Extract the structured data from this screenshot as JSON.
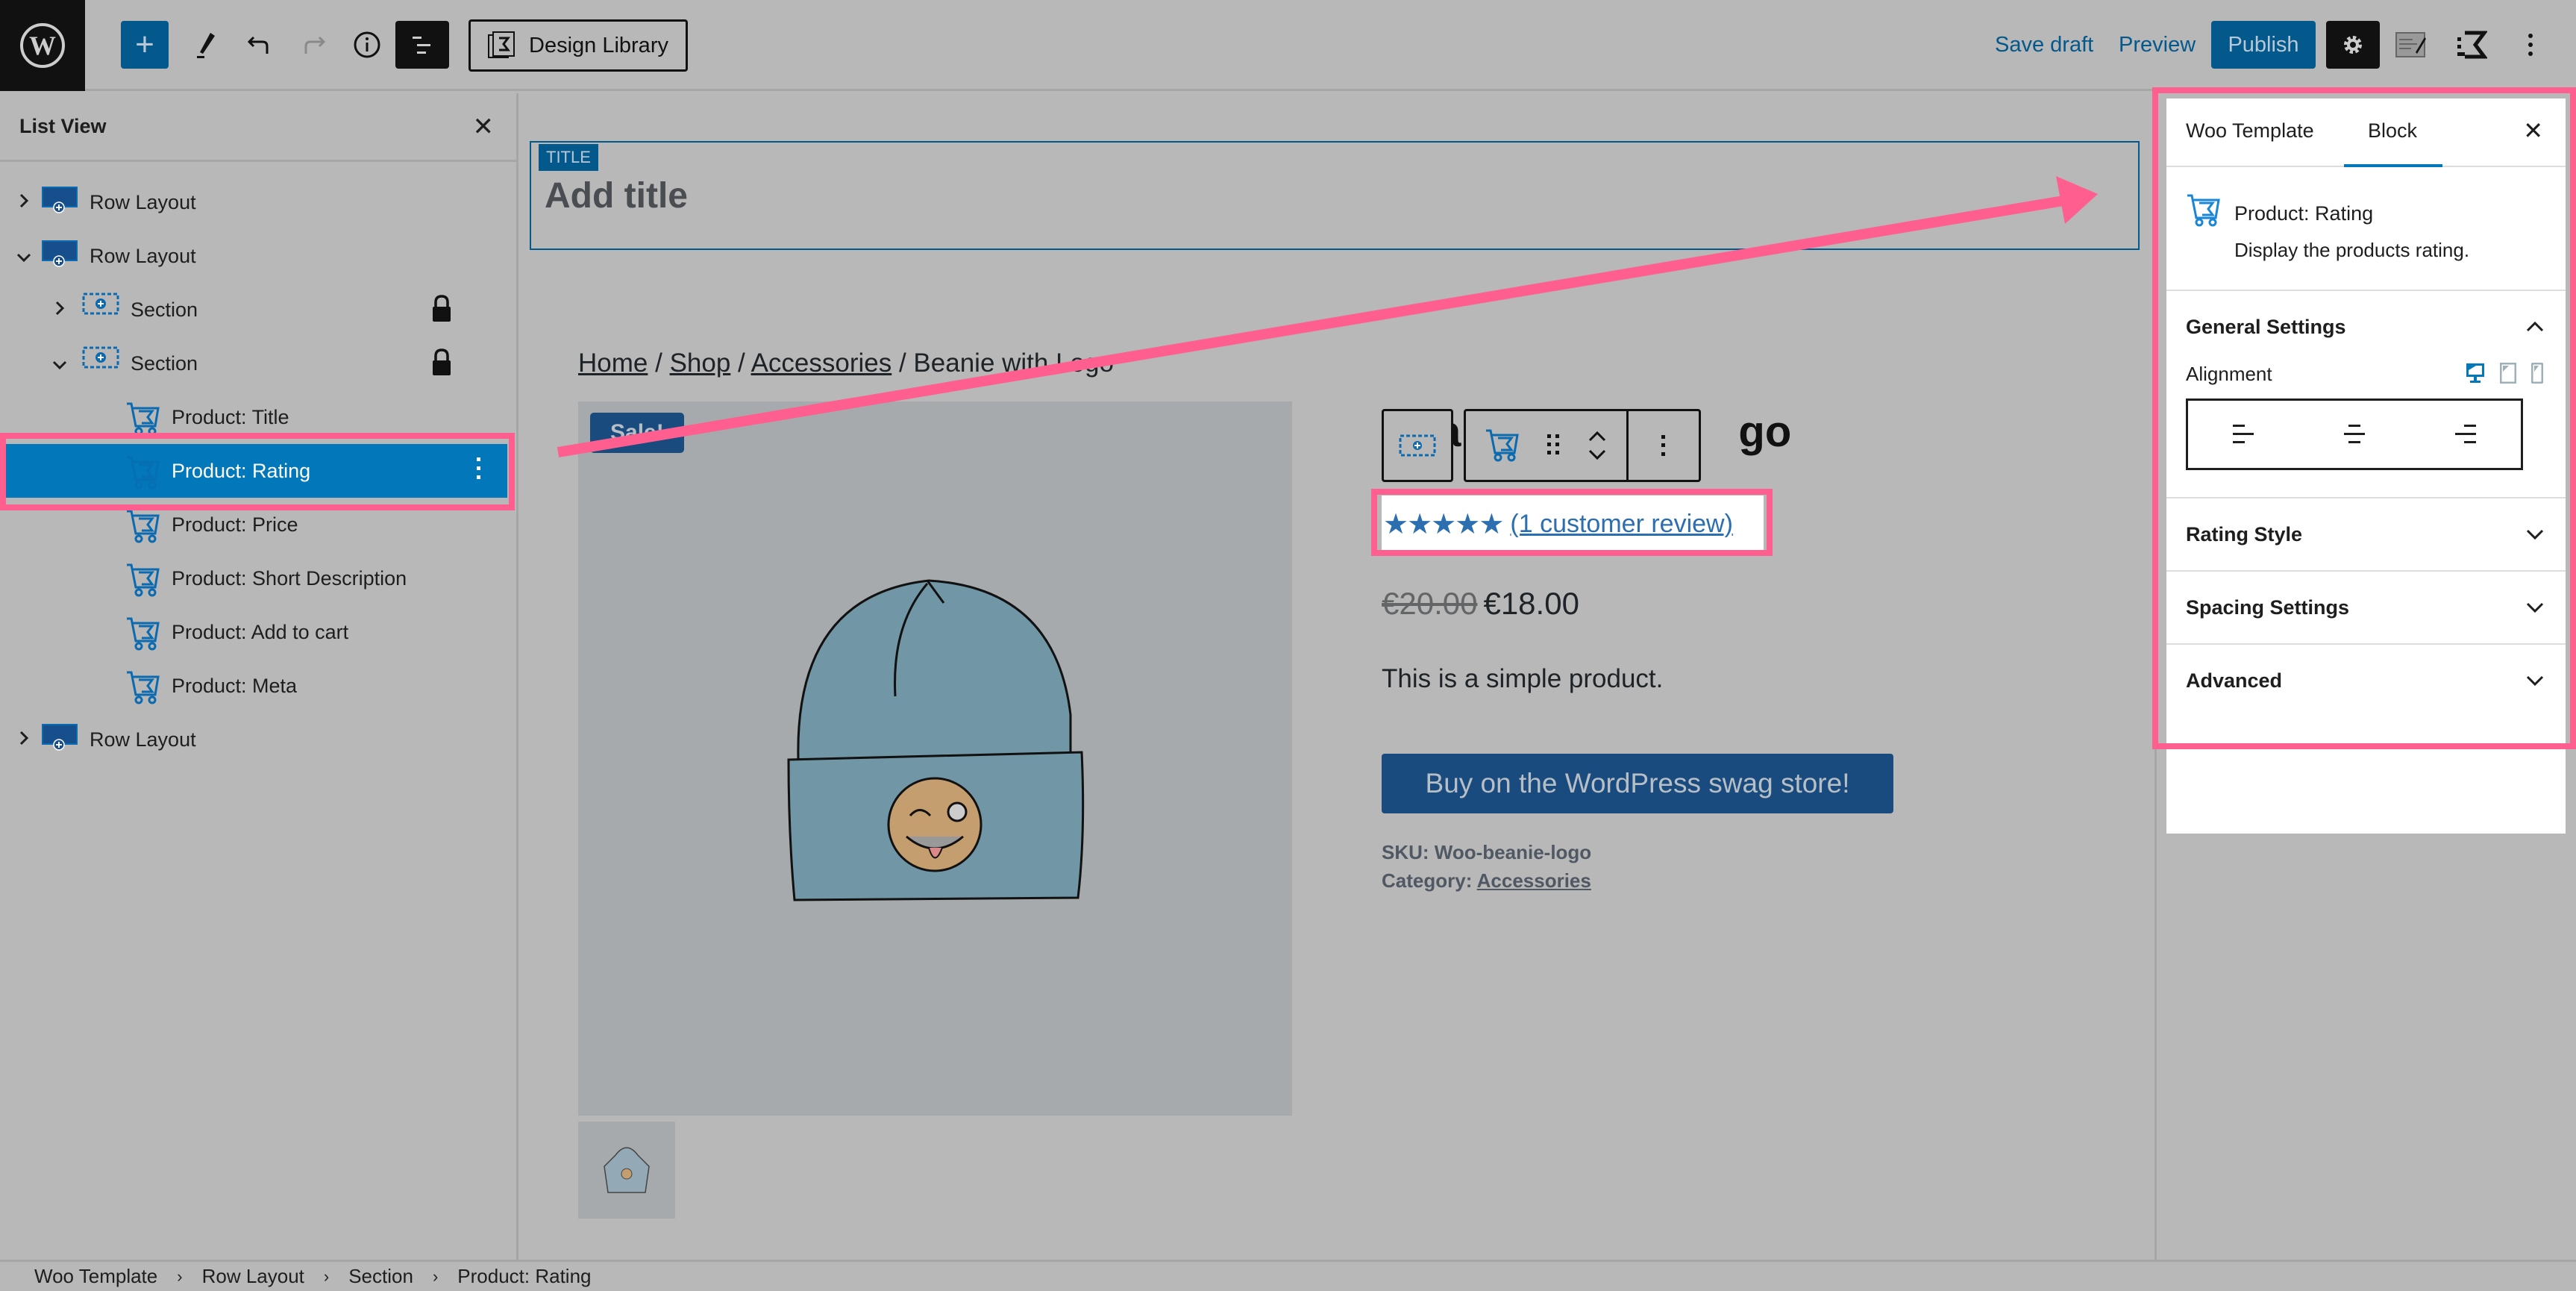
{
  "topbar": {
    "design_library_label": "Design Library",
    "save_draft_label": "Save draft",
    "preview_label": "Preview",
    "publish_label": "Publish"
  },
  "list_view": {
    "title": "List View",
    "items": [
      {
        "label": "Row Layout",
        "level": 0,
        "expander": "collapsed",
        "icon": "row-layout-icon",
        "locked": false,
        "selected": false
      },
      {
        "label": "Row Layout",
        "level": 0,
        "expander": "expanded",
        "icon": "row-layout-icon",
        "locked": false,
        "selected": false
      },
      {
        "label": "Section",
        "level": 1,
        "expander": "collapsed",
        "icon": "section-icon",
        "locked": true,
        "selected": false
      },
      {
        "label": "Section",
        "level": 1,
        "expander": "expanded",
        "icon": "section-icon",
        "locked": true,
        "selected": false
      },
      {
        "label": "Product: Title",
        "level": 2,
        "expander": "none",
        "icon": "product-cart-icon",
        "locked": false,
        "selected": false
      },
      {
        "label": "Product: Rating",
        "level": 2,
        "expander": "none",
        "icon": "product-cart-icon",
        "locked": false,
        "selected": true
      },
      {
        "label": "Product: Price",
        "level": 2,
        "expander": "none",
        "icon": "product-cart-icon",
        "locked": false,
        "selected": false
      },
      {
        "label": "Product: Short Description",
        "level": 2,
        "expander": "none",
        "icon": "product-cart-icon",
        "locked": false,
        "selected": false
      },
      {
        "label": "Product: Add to cart",
        "level": 2,
        "expander": "none",
        "icon": "product-cart-icon",
        "locked": false,
        "selected": false
      },
      {
        "label": "Product: Meta",
        "level": 2,
        "expander": "none",
        "icon": "product-cart-icon",
        "locked": false,
        "selected": false
      },
      {
        "label": "Row Layout",
        "level": 0,
        "expander": "collapsed",
        "icon": "row-layout-icon",
        "locked": false,
        "selected": false
      }
    ]
  },
  "canvas": {
    "title_tag": "TITLE",
    "title_placeholder": "Add title",
    "breadcrumb": {
      "links": [
        "Home",
        "Shop",
        "Accessories"
      ],
      "separator": " / ",
      "current": "Beanie with Logo"
    },
    "sale_badge": "Sale!",
    "product": {
      "title_visible_end": "go",
      "title_visible_start": "a",
      "rating": {
        "stars": 5,
        "max": 5,
        "review_link": "(1 customer review)"
      },
      "regular_price": "€20.00",
      "sale_price": "€18.00",
      "short_description": "This is a simple product.",
      "buy_button": "Buy on the WordPress swag store!",
      "sku_label": "SKU:",
      "sku_value": "Woo-beanie-logo",
      "category_label": "Category:",
      "category_value": "Accessories"
    }
  },
  "sidebar": {
    "tabs": [
      {
        "label": "Woo Template",
        "active": false
      },
      {
        "label": "Block",
        "active": true
      }
    ],
    "block_card": {
      "title": "Product: Rating",
      "description": "Display the products rating."
    },
    "panels": [
      {
        "label": "General Settings",
        "open": true
      },
      {
        "label": "Rating Style",
        "open": false
      },
      {
        "label": "Spacing Settings",
        "open": false
      },
      {
        "label": "Advanced",
        "open": false
      }
    ],
    "alignment": {
      "label": "Alignment",
      "devices": [
        "desktop",
        "tablet",
        "mobile"
      ],
      "active_device": "desktop",
      "options": [
        "left",
        "center",
        "right"
      ]
    }
  },
  "footer": {
    "breadcrumb": [
      "Woo Template",
      "Row Layout",
      "Section",
      "Product: Rating"
    ]
  },
  "colors": {
    "accent": "#0277b9",
    "wp_blue": "#03588c",
    "highlight": "#ff5f8f",
    "star": "#2b6fb0"
  }
}
